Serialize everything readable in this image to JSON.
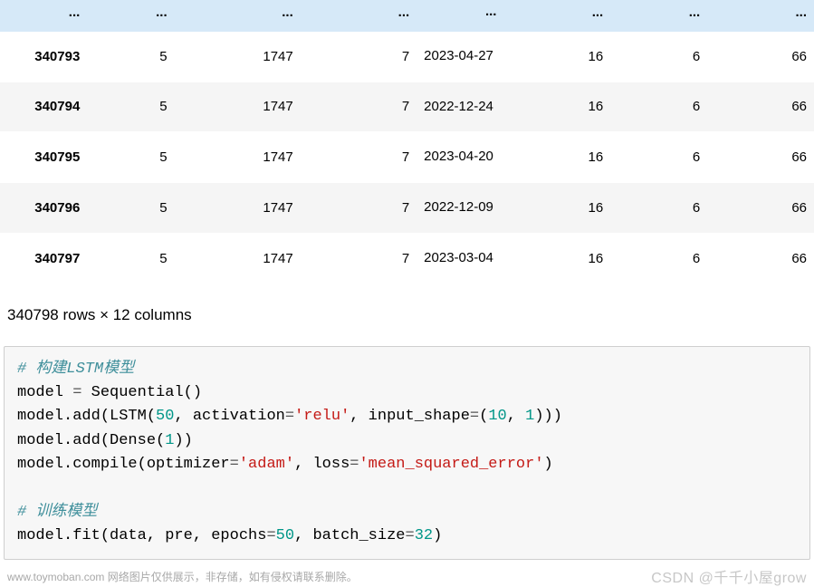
{
  "table": {
    "ellipsis": "...",
    "rows": [
      {
        "idx": "340793",
        "c1": "5",
        "c2": "1747",
        "c3": "7",
        "date": "2023-04-27",
        "c5": "16",
        "c6": "6",
        "c7": "66"
      },
      {
        "idx": "340794",
        "c1": "5",
        "c2": "1747",
        "c3": "7",
        "date": "2022-12-24",
        "c5": "16",
        "c6": "6",
        "c7": "66"
      },
      {
        "idx": "340795",
        "c1": "5",
        "c2": "1747",
        "c3": "7",
        "date": "2023-04-20",
        "c5": "16",
        "c6": "6",
        "c7": "66"
      },
      {
        "idx": "340796",
        "c1": "5",
        "c2": "1747",
        "c3": "7",
        "date": "2022-12-09",
        "c5": "16",
        "c6": "6",
        "c7": "66"
      },
      {
        "idx": "340797",
        "c1": "5",
        "c2": "1747",
        "c3": "7",
        "date": "2023-03-04",
        "c5": "16",
        "c6": "6",
        "c7": "66"
      }
    ]
  },
  "summary": "340798 rows × 12 columns",
  "code": {
    "c1": "# 构建LSTM模型",
    "l2a": "model ",
    "l2b": "=",
    "l2c": " Sequential()",
    "l3a": "model.add(LSTM(",
    "l3b": "50",
    "l3c": ", activation",
    "l3d": "=",
    "l3e": "'relu'",
    "l3f": ", input_shape",
    "l3g": "=",
    "l3h": "(",
    "l3i": "10",
    "l3j": ", ",
    "l3k": "1",
    "l3l": ")))",
    "l4a": "model.add(Dense(",
    "l4b": "1",
    "l4c": "))",
    "l5a": "model.compile(optimizer",
    "l5b": "=",
    "l5c": "'adam'",
    "l5d": ", loss",
    "l5e": "=",
    "l5f": "'mean_squared_error'",
    "l5g": ")",
    "c2": "# 训练模型",
    "l7a": "model.fit(data, pre, epochs",
    "l7b": "=",
    "l7c": "50",
    "l7d": ", batch_size",
    "l7e": "=",
    "l7f": "32",
    "l7g": ")"
  },
  "watermark_left": "www.toymoban.com 网络图片仅供展示，非存储，如有侵权请联系删除。",
  "watermark_right": "CSDN @千千小屋grow"
}
